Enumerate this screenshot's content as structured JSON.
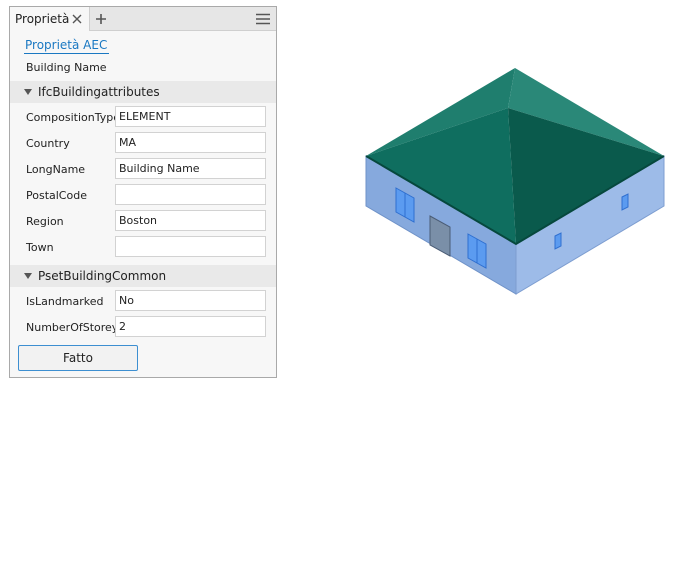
{
  "tabs": {
    "active_label": "Proprietà",
    "close_icon": "close-icon",
    "add_icon": "plus-icon",
    "menu_icon": "hamburger-menu-icon"
  },
  "panel": {
    "link_label": "Proprietà AEC",
    "building_name": "Building Name",
    "sections": [
      {
        "title": "IfcBuildingattributes",
        "fields": [
          {
            "label": "CompositionType",
            "value": "ELEMENT"
          },
          {
            "label": "Country",
            "value": "MA"
          },
          {
            "label": "LongName",
            "value": "Building Name"
          },
          {
            "label": "PostalCode",
            "value": ""
          },
          {
            "label": "Region",
            "value": "Boston"
          },
          {
            "label": "Town",
            "value": ""
          }
        ]
      },
      {
        "title": "PsetBuildingCommon",
        "fields": [
          {
            "label": "IsLandmarked",
            "value": "No"
          },
          {
            "label": "NumberOfStoreys",
            "value": "2"
          }
        ]
      }
    ],
    "done_label": "Fatto"
  },
  "colors": {
    "link": "#1a78c2",
    "roof": "#0e6b5c",
    "walls": "#8fb0e0",
    "windows": "#3a86e6",
    "button_border": "#3d8fd1"
  }
}
